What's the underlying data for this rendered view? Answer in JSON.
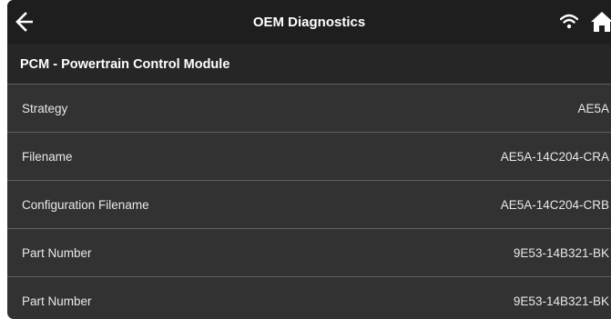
{
  "header": {
    "title": "OEM Diagnostics",
    "back_icon": "arrow-left-icon",
    "wifi_icon": "wifi-icon",
    "home_icon": "home-icon"
  },
  "module": {
    "title": "PCM - Powertrain Control Module"
  },
  "rows": [
    {
      "label": "Strategy",
      "value": "AE5A"
    },
    {
      "label": "Filename",
      "value": "AE5A-14C204-CRA"
    },
    {
      "label": "Configuration Filename",
      "value": "AE5A-14C204-CRB"
    },
    {
      "label": "Part Number",
      "value": "9E53-14B321-BK"
    },
    {
      "label": "Part Number",
      "value": "9E53-14B321-BK"
    }
  ],
  "colors": {
    "topbar": "#1e1e1e",
    "module_header": "#262626",
    "list_background": "#323232",
    "divider": "#5f5f5f",
    "text": "#ffffff"
  }
}
